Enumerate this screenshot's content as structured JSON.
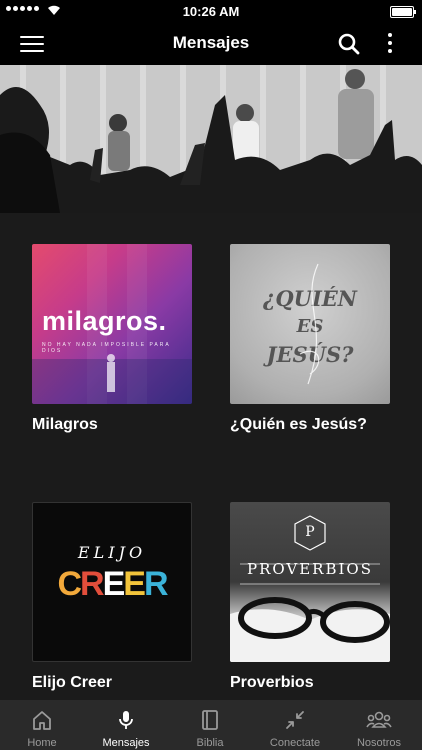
{
  "status_bar": {
    "time": "10:26 AM"
  },
  "navbar": {
    "title": "Mensajes"
  },
  "cards": [
    {
      "label": "Milagros",
      "art_word": "milagros.",
      "art_sub": "NO HAY NADA IMPOSIBLE PARA DIOS"
    },
    {
      "label": "¿Quién es Jesús?",
      "art_lines": [
        "¿QUIÉN",
        "ES",
        "JESÚS?"
      ]
    },
    {
      "label": "Elijo Creer",
      "art_top": "ELIJO",
      "art_letters": [
        "C",
        "R",
        "E",
        "E",
        "R"
      ]
    },
    {
      "label": "Proverbios",
      "art_logo": "P",
      "art_word": "PROVERBIOS"
    }
  ],
  "tabs": [
    {
      "label": "Home",
      "active": false
    },
    {
      "label": "Mensajes",
      "active": true
    },
    {
      "label": "Biblia",
      "active": false
    },
    {
      "label": "Conectate",
      "active": false
    },
    {
      "label": "Nosotros",
      "active": false
    }
  ],
  "colors": {
    "background": "#1b1b1b",
    "bar": "#000000",
    "tabbar": "#2a2a2a",
    "tab_inactive": "#9a9a9a"
  }
}
